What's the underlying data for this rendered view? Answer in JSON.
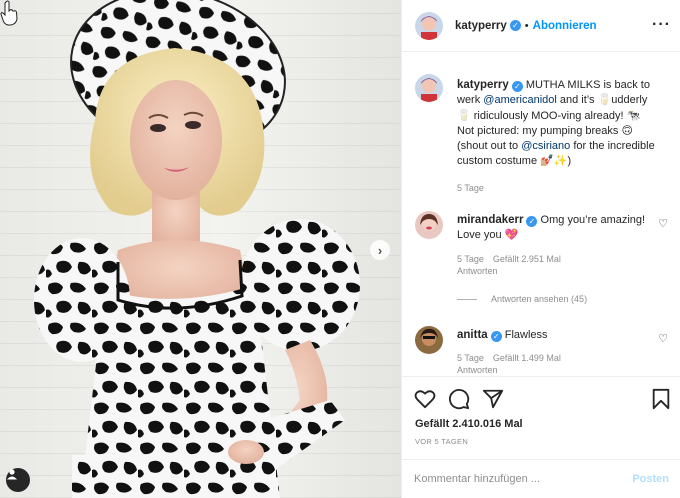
{
  "post": {
    "username": "katyperry",
    "verified_icon": "verified-badge-icon",
    "follow_label": "Abonnieren",
    "more_icon": "more-options-icon"
  },
  "caption": {
    "username": "katyperry",
    "text_1": "MUTHA MILKS is back to werk",
    "mention_1": "@americanidol",
    "text_2": "and it’s 🥛udderly 🥛 ridiculously MOO-ving already! 🐄 Not pictured: my pumping breaks 🙃 (shout out to",
    "mention_2": "@csiriano",
    "text_3": "for the incredible custom costume 💅🏼✨)",
    "time": "5 Tage"
  },
  "comments": [
    {
      "username": "mirandakerr",
      "verified": true,
      "text": "Omg you’re amazing! Love you 💖",
      "time": "5 Tage",
      "likes": "Gefällt 2.951 Mal",
      "reply": "Antworten",
      "view_replies": "Antworten ansehen (45)"
    },
    {
      "username": "anitta",
      "verified": true,
      "text": "Flawless",
      "time": "5 Tage",
      "likes": "Gefällt 1.499 Mal",
      "reply": "Antworten"
    }
  ],
  "actions": {
    "like_icon": "heart-icon",
    "comment_icon": "comment-bubble-icon",
    "share_icon": "share-paper-plane-icon",
    "save_icon": "bookmark-icon",
    "likes": "Gefällt 2.410.016 Mal",
    "posted_ago": "VOR 5 TAGEN"
  },
  "add_comment": {
    "placeholder": "Kommentar hinzufügen ...",
    "post_label": "Posten"
  },
  "colors": {
    "accent": "#0095f6",
    "verified": "#3897f0",
    "muted": "#8e8e8e",
    "text": "#262626",
    "post_disabled": "#b2dffc"
  }
}
